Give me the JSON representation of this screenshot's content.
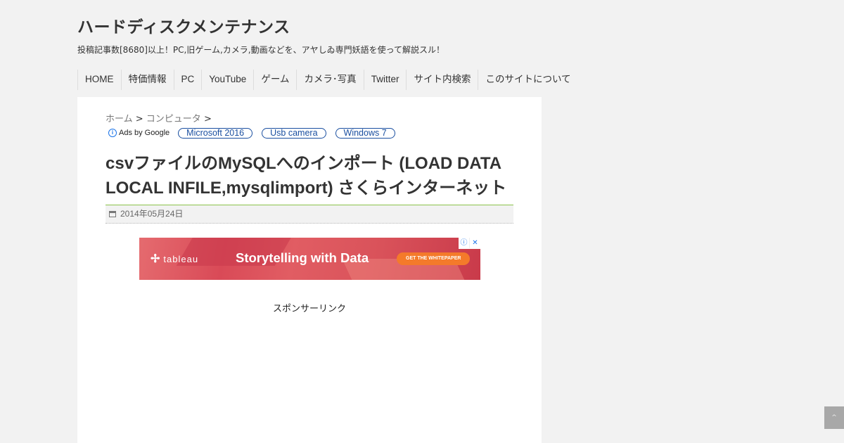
{
  "site": {
    "title": "ハードディスクメンテナンス",
    "description": "投稿記事数[8680]以上！PC,旧ゲーム,カメラ,動画などを、アヤしゐ専門妖語を使って解説スル！"
  },
  "nav": {
    "items": [
      {
        "label": "HOME"
      },
      {
        "label": "特価情報"
      },
      {
        "label": "PC"
      },
      {
        "label": "YouTube"
      },
      {
        "label": "ゲーム"
      },
      {
        "label": "カメラ･写真"
      },
      {
        "label": "Twitter"
      },
      {
        "label": "サイト内検索"
      },
      {
        "label": "このサイトについて"
      }
    ]
  },
  "breadcrumb": {
    "home": "ホーム",
    "sep1": " > ",
    "category": "コンピュータ",
    "sep2": " >"
  },
  "ads_bar": {
    "label": "Ads by Google",
    "chips": [
      "Microsoft 2016",
      "Usb camera",
      "Windows 7"
    ]
  },
  "post": {
    "title": "csvファイルのMySQLへのインポート (LOAD DATA LOCAL INFILE,mysqlimport) さくらインターネット",
    "date": "2014年05月24日"
  },
  "banner": {
    "brand": "tableau",
    "headline": "Storytelling with Data",
    "cta": "GET THE WHITEPAPER",
    "info_glyph": "ⓘ",
    "close_glyph": "✕"
  },
  "sponsor": {
    "label": "スポンサーリンク"
  },
  "back_to_top": {
    "glyph": "^"
  }
}
